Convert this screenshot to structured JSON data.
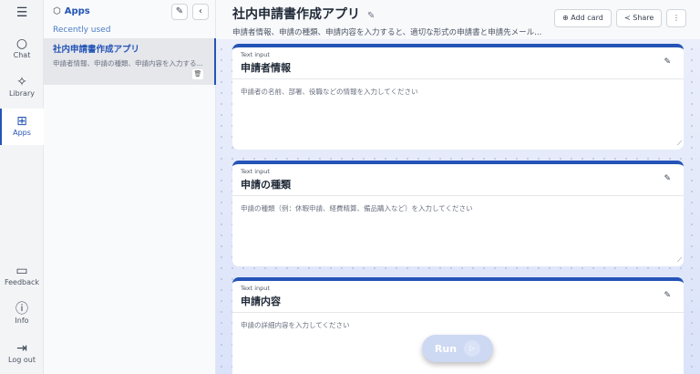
{
  "rail": {
    "items": [
      {
        "label": "Chat",
        "icon": "chat-icon"
      },
      {
        "label": "Library",
        "icon": "sparkle-icon"
      },
      {
        "label": "Apps",
        "icon": "apps-icon"
      },
      {
        "label": "Feedback",
        "icon": "feedback-icon"
      },
      {
        "label": "Info",
        "icon": "info-icon"
      },
      {
        "label": "Log out",
        "icon": "logout-icon"
      }
    ]
  },
  "panel": {
    "title": "Apps",
    "recent_label": "Recently used",
    "apps": [
      {
        "name": "社内申請書作成アプリ",
        "desc": "申請者情報、申請の種類、申請内容を入力する..."
      }
    ]
  },
  "header": {
    "title": "社内申請書作成アプリ",
    "subtitle": "申請者情報、申請の種類、申請内容を入力すると、適切な形式の申請書と申請先メール...",
    "add_card": "Add card",
    "share": "Share"
  },
  "cards": [
    {
      "type": "Text input",
      "label": "申請者情報",
      "placeholder": "申請者の名前、部署、役職などの情報を入力してください"
    },
    {
      "type": "Text input",
      "label": "申請の種類",
      "placeholder": "申請の種類（例：休暇申請、経費精算、備品購入など）を入力してください"
    },
    {
      "type": "Text input",
      "label": "申請内容",
      "placeholder": "申請の詳細内容を入力してください"
    }
  ],
  "run_label": "Run",
  "colors": {
    "accent": "#2454b6"
  }
}
